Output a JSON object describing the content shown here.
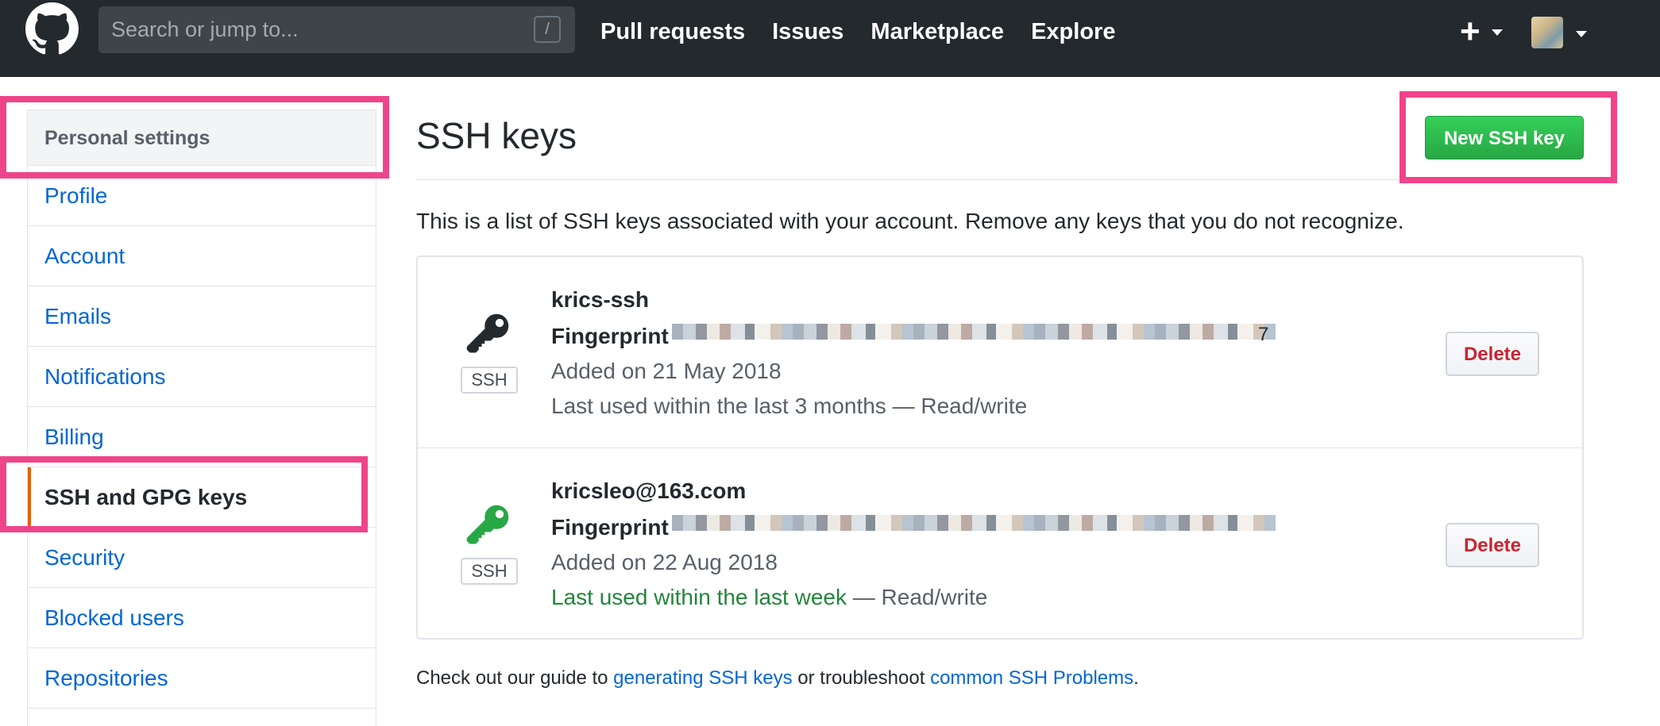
{
  "header": {
    "search_placeholder": "Search or jump to...",
    "search_shortcut": "/",
    "nav": [
      "Pull requests",
      "Issues",
      "Marketplace",
      "Explore"
    ],
    "plus_icon": "plus-icon",
    "avatar_icon": "user-avatar"
  },
  "sidebar": {
    "heading": "Personal settings",
    "items": [
      "Profile",
      "Account",
      "Emails",
      "Notifications",
      "Billing",
      "SSH and GPG keys",
      "Security",
      "Blocked users",
      "Repositories"
    ],
    "selected": "SSH and GPG keys"
  },
  "main": {
    "title": "SSH keys",
    "new_key_button": "New SSH key",
    "intro": "This is a list of SSH keys associated with your account. Remove any keys that you do not recognize.",
    "keys": [
      {
        "title": "krics-ssh",
        "fingerprint_label": "Fingerprint",
        "fingerprint_tail": "7",
        "added": "Added on 21 May 2018",
        "used_prefix": "Last used within the last 3 months",
        "used_suffix": " — Read/write",
        "type_label": "SSH",
        "icon_color": "#24292e",
        "delete_label": "Delete"
      },
      {
        "title": "kricsleo@163.com",
        "fingerprint_label": "Fingerprint",
        "fingerprint_tail": "",
        "added": "Added on 22 Aug 2018",
        "used_prefix": "Last used within the last week",
        "used_suffix": " — Read/write",
        "type_label": "SSH",
        "icon_color": "#28a745",
        "delete_label": "Delete"
      }
    ],
    "footer": {
      "part1": "Check out our guide to ",
      "link1": "generating SSH keys",
      "part2": " or troubleshoot ",
      "link2": "common SSH Problems",
      "part3": "."
    }
  },
  "colors": {
    "header_bg": "#24292e",
    "accent_green": "#28a745",
    "link_blue": "#0366d6",
    "delete_red": "#cb2431",
    "annotation_pink": "#f0448a"
  }
}
